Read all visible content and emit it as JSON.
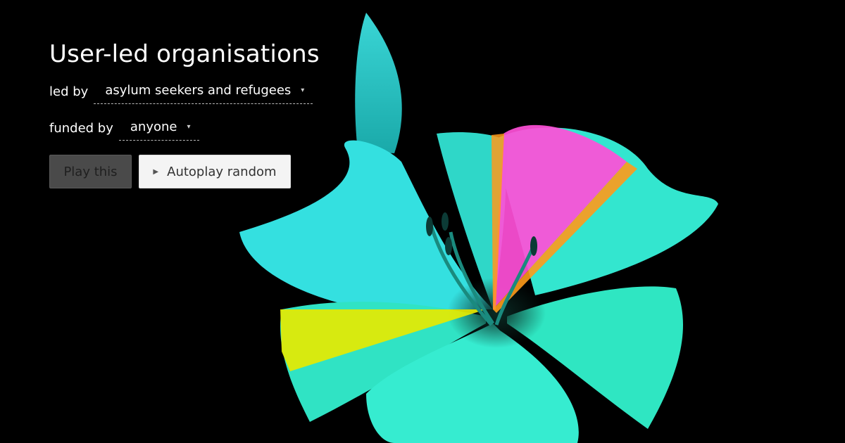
{
  "title": "User-led organisations",
  "filters": {
    "led_by": {
      "label": "led by",
      "value": "asylum seekers and refugees"
    },
    "funded_by": {
      "label": "funded by",
      "value": "anyone"
    }
  },
  "buttons": {
    "play": "Play this",
    "autoplay": "Autoplay random"
  },
  "icons": {
    "dropdown": "chevron-down-icon",
    "autoplay": "play-icon"
  },
  "colors": {
    "background": "#000000",
    "flower": "#2ee8c8",
    "highlight_pink": "#ff4fd8",
    "highlight_orange": "#ff9a1a",
    "highlight_yellow": "#e6ea00"
  }
}
